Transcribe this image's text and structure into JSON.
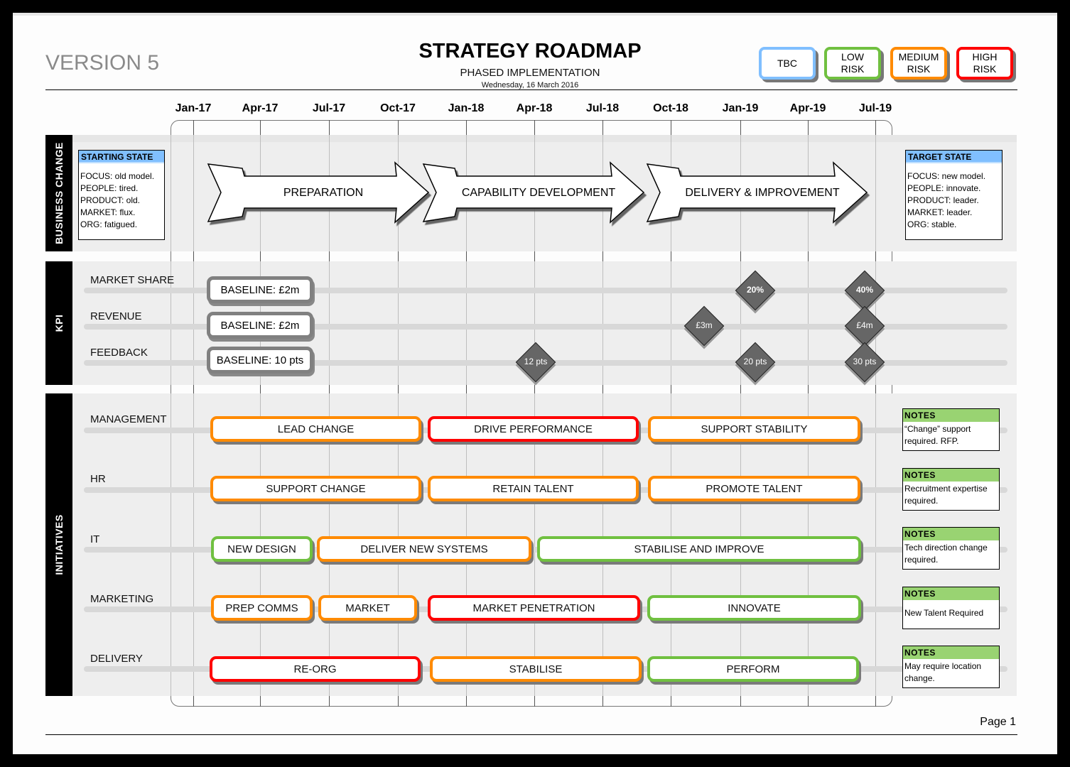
{
  "header": {
    "version": "VERSION 5",
    "title": "STRATEGY ROADMAP",
    "subtitle": "PHASED IMPLEMENTATION",
    "date": "Wednesday, 16 March 2016"
  },
  "legend": [
    {
      "label": "TBC",
      "color": "#80bfff"
    },
    {
      "label": "LOW\nRISK",
      "color": "#70c040"
    },
    {
      "label": "MEDIUM\nRISK",
      "color": "#ff8a00"
    },
    {
      "label": "HIGH\nRISK",
      "color": "#ff0000"
    }
  ],
  "timeline": {
    "months": [
      "Jan-17",
      "Apr-17",
      "Jul-17",
      "Oct-17",
      "Jan-18",
      "Apr-18",
      "Jul-18",
      "Oct-18",
      "Jan-19",
      "Apr-19",
      "Jul-19"
    ]
  },
  "sections": {
    "business_change": "BUSINESS CHANGE",
    "kpi": "KPI",
    "initiatives": "INITIATIVES"
  },
  "business_change": {
    "starting_state": {
      "title": "STARTING STATE",
      "lines": [
        "FOCUS: old model.",
        "PEOPLE: tired.",
        "PRODUCT: old.",
        "MARKET: flux.",
        "ORG: fatigued."
      ]
    },
    "target_state": {
      "title": "TARGET STATE",
      "lines": [
        "FOCUS: new  model.",
        "PEOPLE: innovate.",
        "PRODUCT: leader.",
        "MARKET: leader.",
        "ORG: stable."
      ]
    },
    "phases": [
      "PREPARATION",
      "CAPABILITY DEVELOPMENT",
      "DELIVERY & IMPROVEMENT"
    ]
  },
  "kpis": [
    {
      "label": "MARKET SHARE",
      "baseline": "BASELINE: £2m",
      "milestones": [
        {
          "label": "20%",
          "bold": true,
          "date": "Jan-19"
        },
        {
          "label": "40%",
          "bold": true,
          "date": "Jul-19"
        }
      ]
    },
    {
      "label": "REVENUE",
      "baseline": "BASELINE: £2m",
      "milestones": [
        {
          "label": "£3m",
          "date": "Nov-18"
        },
        {
          "label": "£4m",
          "date": "Jul-19"
        }
      ]
    },
    {
      "label": "FEEDBACK",
      "baseline": "BASELINE: 10 pts",
      "milestones": [
        {
          "label": "12 pts",
          "date": "Apr-18"
        },
        {
          "label": "20 pts",
          "date": "Jan-19"
        },
        {
          "label": "30 pts",
          "date": "Jul-19"
        }
      ]
    }
  ],
  "initiatives": [
    {
      "label": "MANAGEMENT",
      "bars": [
        {
          "text": "LEAD CHANGE",
          "risk": "medium"
        },
        {
          "text": "DRIVE PERFORMANCE",
          "risk": "high"
        },
        {
          "text": "SUPPORT STABILITY",
          "risk": "medium"
        }
      ],
      "notes": {
        "title": "NOTES",
        "text": "“Change” support required. RFP."
      }
    },
    {
      "label": "HR",
      "bars": [
        {
          "text": "SUPPORT CHANGE",
          "risk": "medium"
        },
        {
          "text": "RETAIN TALENT",
          "risk": "medium"
        },
        {
          "text": "PROMOTE TALENT",
          "risk": "medium"
        }
      ],
      "notes": {
        "title": "NOTES",
        "text": "Recruitment expertise required."
      }
    },
    {
      "label": "IT",
      "bars": [
        {
          "text": "NEW DESIGN",
          "risk": "low"
        },
        {
          "text": "DELIVER NEW SYSTEMS",
          "risk": "medium"
        },
        {
          "text": "STABILISE AND IMPROVE",
          "risk": "low"
        }
      ],
      "notes": {
        "title": "NOTES",
        "text": "Tech direction change required."
      }
    },
    {
      "label": "MARKETING",
      "bars": [
        {
          "text": "PREP COMMS",
          "risk": "medium"
        },
        {
          "text": "MARKET",
          "risk": "medium"
        },
        {
          "text": "MARKET PENETRATION",
          "risk": "high"
        },
        {
          "text": "INNOVATE",
          "risk": "low"
        }
      ],
      "notes": {
        "title": "NOTES",
        "text": "New Talent Required"
      }
    },
    {
      "label": "DELIVERY",
      "bars": [
        {
          "text": "RE-ORG",
          "risk": "high"
        },
        {
          "text": "STABILISE",
          "risk": "medium"
        },
        {
          "text": "PERFORM",
          "risk": "low"
        }
      ],
      "notes": {
        "title": "NOTES",
        "text": "May require location change."
      }
    }
  ],
  "footer": {
    "page": "Page 1"
  }
}
